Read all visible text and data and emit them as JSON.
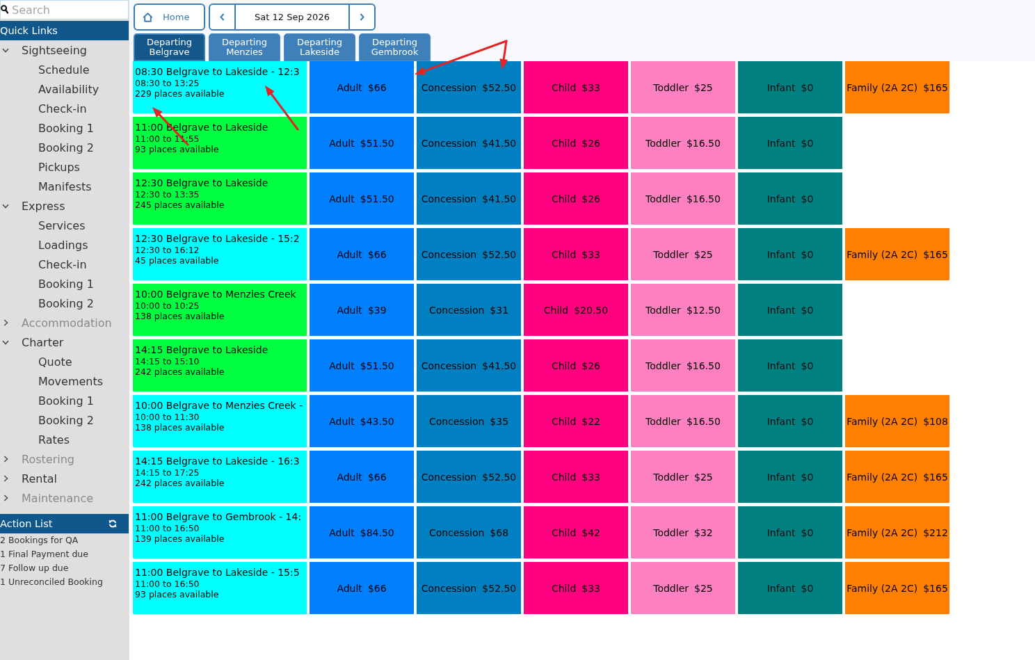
{
  "sidebar": {
    "search": {
      "placeholder": "Search"
    },
    "quick_links": {
      "title": "Quick Links",
      "items": [
        {
          "label": "Sightseeing",
          "expanded": true,
          "disabled": false,
          "children": [
            {
              "label": "Schedule"
            },
            {
              "label": "Availability"
            },
            {
              "label": "Check-in"
            },
            {
              "label": "Booking 1"
            },
            {
              "label": "Booking 2"
            },
            {
              "label": "Pickups"
            },
            {
              "label": "Manifests"
            }
          ]
        },
        {
          "label": "Express",
          "expanded": true,
          "disabled": false,
          "children": [
            {
              "label": "Services"
            },
            {
              "label": "Loadings"
            },
            {
              "label": "Check-in"
            },
            {
              "label": "Booking 1"
            },
            {
              "label": "Booking 2"
            }
          ]
        },
        {
          "label": "Accommodation",
          "expanded": false,
          "disabled": true
        },
        {
          "label": "Charter",
          "expanded": true,
          "disabled": false,
          "children": [
            {
              "label": "Quote"
            },
            {
              "label": "Movements"
            },
            {
              "label": "Booking 1"
            },
            {
              "label": "Booking 2"
            },
            {
              "label": "Rates"
            }
          ]
        },
        {
          "label": "Rostering",
          "expanded": false,
          "disabled": true
        },
        {
          "label": "Rental",
          "expanded": false,
          "disabled": false
        },
        {
          "label": "Maintenance",
          "expanded": false,
          "disabled": true
        }
      ]
    },
    "action_list": {
      "title": "Action List",
      "items": [
        "2 Bookings for QA",
        "1 Final Payment due",
        "7 Follow up due",
        "1 Unreconciled Booking"
      ]
    }
  },
  "toolbar": {
    "home": "Home",
    "date": "Sat 12 Sep 2026"
  },
  "tabs": [
    {
      "label": "Departing Belgrave",
      "selected": true
    },
    {
      "label": "Departing Menzies",
      "selected": false
    },
    {
      "label": "Departing Lakeside",
      "selected": false
    },
    {
      "label": "Departing Gembrook",
      "selected": false
    }
  ],
  "services": [
    {
      "title": "08:30 Belgrave to Lakeside - 12:3",
      "times": "08:30 to 13:25",
      "availability": "229 places available",
      "color": "#00ffff",
      "fares": [
        {
          "kind": "adult",
          "label": "Adult",
          "price": "$66"
        },
        {
          "kind": "concession",
          "label": "Concession",
          "price": "$52.50"
        },
        {
          "kind": "child",
          "label": "Child",
          "price": "$33"
        },
        {
          "kind": "toddler",
          "label": "Toddler",
          "price": "$25"
        },
        {
          "kind": "infant",
          "label": "Infant",
          "price": "$0"
        },
        {
          "kind": "family",
          "label": "Family (2A 2C)",
          "price": "$165"
        }
      ]
    },
    {
      "title": "11:00 Belgrave to Lakeside",
      "times": "11:00 to 11:55",
      "availability": "93 places available",
      "color": "#00ff40",
      "fares": [
        {
          "kind": "adult",
          "label": "Adult",
          "price": "$51.50"
        },
        {
          "kind": "concession",
          "label": "Concession",
          "price": "$41.50"
        },
        {
          "kind": "child",
          "label": "Child",
          "price": "$26"
        },
        {
          "kind": "toddler",
          "label": "Toddler",
          "price": "$16.50"
        },
        {
          "kind": "infant",
          "label": "Infant",
          "price": "$0"
        }
      ]
    },
    {
      "title": "12:30 Belgrave to Lakeside",
      "times": "12:30 to 13:35",
      "availability": "245 places available",
      "color": "#00ff40",
      "fares": [
        {
          "kind": "adult",
          "label": "Adult",
          "price": "$51.50"
        },
        {
          "kind": "concession",
          "label": "Concession",
          "price": "$41.50"
        },
        {
          "kind": "child",
          "label": "Child",
          "price": "$26"
        },
        {
          "kind": "toddler",
          "label": "Toddler",
          "price": "$16.50"
        },
        {
          "kind": "infant",
          "label": "Infant",
          "price": "$0"
        }
      ]
    },
    {
      "title": "12:30 Belgrave to Lakeside - 15:2",
      "times": "12:30 to 16:12",
      "availability": "45 places available",
      "color": "#00ffff",
      "fares": [
        {
          "kind": "adult",
          "label": "Adult",
          "price": "$66"
        },
        {
          "kind": "concession",
          "label": "Concession",
          "price": "$52.50"
        },
        {
          "kind": "child",
          "label": "Child",
          "price": "$33"
        },
        {
          "kind": "toddler",
          "label": "Toddler",
          "price": "$25"
        },
        {
          "kind": "infant",
          "label": "Infant",
          "price": "$0"
        },
        {
          "kind": "family",
          "label": "Family (2A 2C)",
          "price": "$165"
        }
      ]
    },
    {
      "title": "10:00 Belgrave to Menzies Creek",
      "times": "10:00 to 10:25",
      "availability": "138 places available",
      "color": "#00ff40",
      "fares": [
        {
          "kind": "adult",
          "label": "Adult",
          "price": "$39"
        },
        {
          "kind": "concession",
          "label": "Concession",
          "price": "$31"
        },
        {
          "kind": "child",
          "label": "Child",
          "price": "$20.50"
        },
        {
          "kind": "toddler",
          "label": "Toddler",
          "price": "$12.50"
        },
        {
          "kind": "infant",
          "label": "Infant",
          "price": "$0"
        }
      ]
    },
    {
      "title": "14:15 Belgrave to Lakeside",
      "times": "14:15 to 15:10",
      "availability": "242 places available",
      "color": "#00ff40",
      "fares": [
        {
          "kind": "adult",
          "label": "Adult",
          "price": "$51.50"
        },
        {
          "kind": "concession",
          "label": "Concession",
          "price": "$41.50"
        },
        {
          "kind": "child",
          "label": "Child",
          "price": "$26"
        },
        {
          "kind": "toddler",
          "label": "Toddler",
          "price": "$16.50"
        },
        {
          "kind": "infant",
          "label": "Infant",
          "price": "$0"
        }
      ]
    },
    {
      "title": "10:00 Belgrave to Menzies Creek -",
      "times": "10:00 to 11:30",
      "availability": "138 places available",
      "color": "#00ffff",
      "fares": [
        {
          "kind": "adult",
          "label": "Adult",
          "price": "$43.50"
        },
        {
          "kind": "concession",
          "label": "Concession",
          "price": "$35"
        },
        {
          "kind": "child",
          "label": "Child",
          "price": "$22"
        },
        {
          "kind": "toddler",
          "label": "Toddler",
          "price": "$16.50"
        },
        {
          "kind": "infant",
          "label": "Infant",
          "price": "$0"
        },
        {
          "kind": "family",
          "label": "Family (2A 2C)",
          "price": "$108"
        }
      ]
    },
    {
      "title": "14:15 Belgrave to Lakeside - 16:3",
      "times": "14:15 to 17:25",
      "availability": "242 places available",
      "color": "#00ffff",
      "fares": [
        {
          "kind": "adult",
          "label": "Adult",
          "price": "$66"
        },
        {
          "kind": "concession",
          "label": "Concession",
          "price": "$52.50"
        },
        {
          "kind": "child",
          "label": "Child",
          "price": "$33"
        },
        {
          "kind": "toddler",
          "label": "Toddler",
          "price": "$25"
        },
        {
          "kind": "infant",
          "label": "Infant",
          "price": "$0"
        },
        {
          "kind": "family",
          "label": "Family (2A 2C)",
          "price": "$165"
        }
      ]
    },
    {
      "title": "11:00 Belgrave to Gembrook - 14:",
      "times": "11:00 to 16:50",
      "availability": "139 places available",
      "color": "#00ffff",
      "fares": [
        {
          "kind": "adult",
          "label": "Adult",
          "price": "$84.50"
        },
        {
          "kind": "concession",
          "label": "Concession",
          "price": "$68"
        },
        {
          "kind": "child",
          "label": "Child",
          "price": "$42"
        },
        {
          "kind": "toddler",
          "label": "Toddler",
          "price": "$32"
        },
        {
          "kind": "infant",
          "label": "Infant",
          "price": "$0"
        },
        {
          "kind": "family",
          "label": "Family (2A 2C)",
          "price": "$212"
        }
      ]
    },
    {
      "title": "11:00 Belgrave to Lakeside - 15:5",
      "times": "11:00 to 16:50",
      "availability": "93 places available",
      "color": "#00ffff",
      "fares": [
        {
          "kind": "adult",
          "label": "Adult",
          "price": "$66"
        },
        {
          "kind": "concession",
          "label": "Concession",
          "price": "$52.50"
        },
        {
          "kind": "child",
          "label": "Child",
          "price": "$33"
        },
        {
          "kind": "toddler",
          "label": "Toddler",
          "price": "$25"
        },
        {
          "kind": "infant",
          "label": "Infant",
          "price": "$0"
        },
        {
          "kind": "family",
          "label": "Family (2A 2C)",
          "price": "$165"
        }
      ]
    }
  ]
}
